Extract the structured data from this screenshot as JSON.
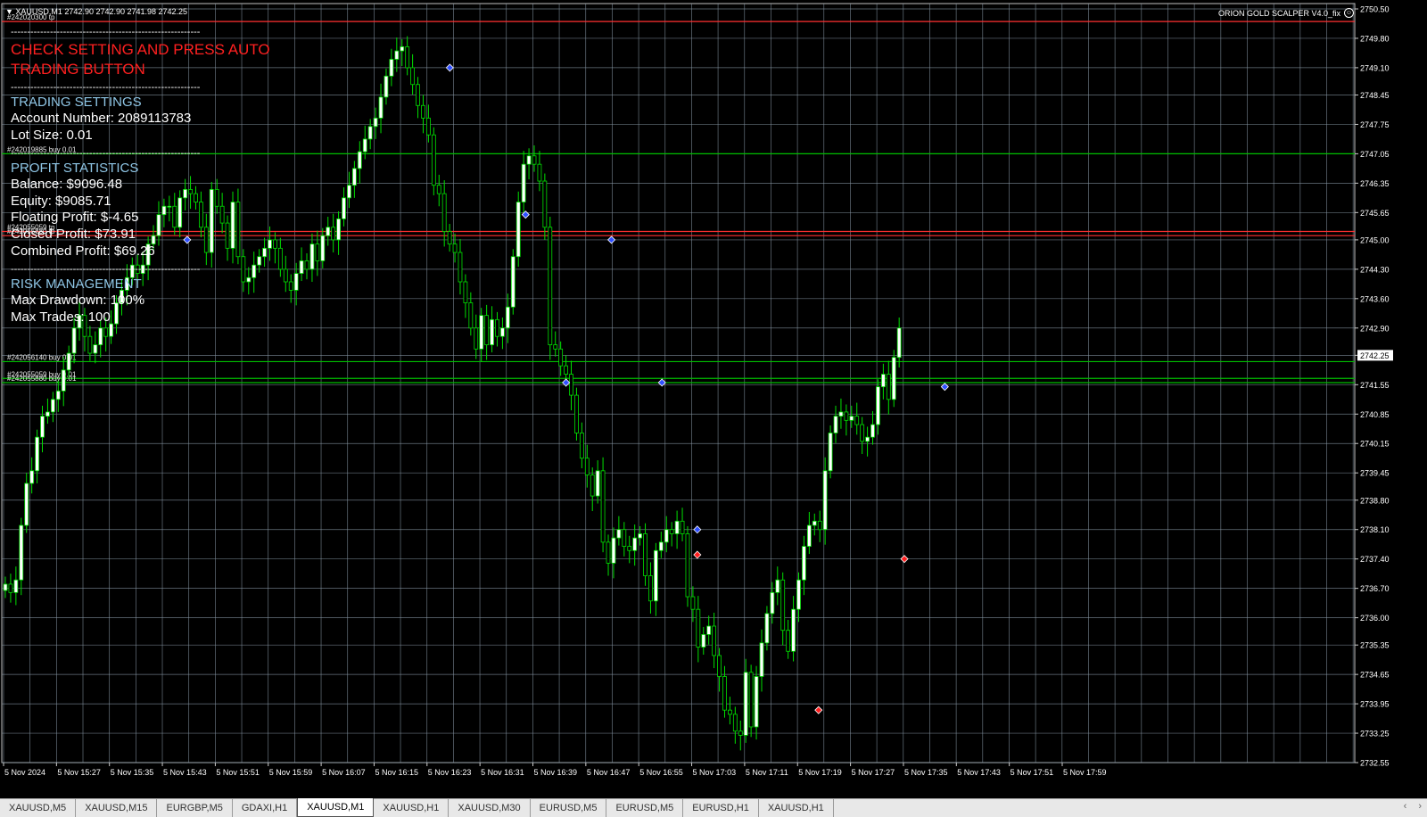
{
  "window": {
    "symbol_info": "▼ XAUUSD,M1  2742.90 2742.90 2741.98 2742.25",
    "ea_name": "ORION GOLD SCALPER V4.0_fix",
    "ea_icon": "smiley-icon"
  },
  "panel": {
    "separator": "----------------------------------------------------------",
    "warning": "CHECK SETTING AND PRESS AUTO TRADING BUTTON",
    "trading_settings": {
      "title": "TRADING SETTINGS",
      "account": "Account Number: 2089113783",
      "lot": "Lot Size: 0.01"
    },
    "profit_statistics": {
      "title": "PROFIT STATISTICS",
      "balance": "Balance: $9096.48",
      "equity": "Equity: $9085.71",
      "floating": "Floating Profit: $-4.65",
      "closed": "Closed Profit: $73.91",
      "combined": "Combined Profit: $69.26"
    },
    "risk_management": {
      "title": "RISK MANAGEMENT",
      "drawdown": "Max Drawdown: 100%",
      "trades": "Max Trades: 100"
    }
  },
  "order_labels": [
    {
      "text": "#242020300 tp",
      "price": 2750.2,
      "color": "#ff3030"
    },
    {
      "text": "#242019885 buy 0.01",
      "price": 2747.05,
      "color": "#00c000"
    },
    {
      "text": "#242055059 tp",
      "price": 2745.2,
      "color": "#ff3030"
    },
    {
      "text": "#242055880 tp",
      "price": 2745.1,
      "color": "#ff3030"
    },
    {
      "text": "#242056140 buy 0.01",
      "price": 2742.1,
      "color": "#00c000"
    },
    {
      "text": "#242055059 buy 0.01",
      "price": 2741.7,
      "color": "#00c000"
    },
    {
      "text": "#242055880 buy 0.01",
      "price": 2741.6,
      "color": "#00c000"
    }
  ],
  "colors": {
    "grid": "#8a9aa8",
    "bull_body": "#ffffff",
    "wick": "#00e000",
    "tp_line": "#d01010",
    "entry_line": "#00a000",
    "axis_text": "#ffffff",
    "price_box_bg": "#ffffff",
    "arrow_buy": "#3050ff",
    "arrow_sell": "#ff2020"
  },
  "price_axis": {
    "labels": [
      "2750.50",
      "2749.80",
      "2749.10",
      "2748.45",
      "2747.75",
      "2747.05",
      "2746.35",
      "2745.65",
      "2745.00",
      "2744.30",
      "2743.60",
      "2742.90",
      "2742.25",
      "2741.55",
      "2740.85",
      "2740.15",
      "2739.45",
      "2738.80",
      "2738.10",
      "2737.40",
      "2736.70",
      "2736.00",
      "2735.35",
      "2734.65",
      "2733.95",
      "2733.25",
      "2732.55"
    ],
    "current_price": "2742.25"
  },
  "time_axis": {
    "labels": [
      "5 Nov 2024",
      "5 Nov 15:27",
      "5 Nov 15:35",
      "5 Nov 15:43",
      "5 Nov 15:51",
      "5 Nov 15:59",
      "5 Nov 16:07",
      "5 Nov 16:15",
      "5 Nov 16:23",
      "5 Nov 16:31",
      "5 Nov 16:39",
      "5 Nov 16:47",
      "5 Nov 16:55",
      "5 Nov 17:03",
      "5 Nov 17:11",
      "5 Nov 17:19",
      "5 Nov 17:27",
      "5 Nov 17:35",
      "5 Nov 17:43",
      "5 Nov 17:51",
      "5 Nov 17:59"
    ]
  },
  "tabs": [
    {
      "label": "XAUUSD,M5",
      "active": false
    },
    {
      "label": "XAUUSD,M15",
      "active": false
    },
    {
      "label": "EURGBP,M5",
      "active": false
    },
    {
      "label": "GDAXI,H1",
      "active": false
    },
    {
      "label": "XAUUSD,M1",
      "active": true
    },
    {
      "label": "XAUUSD,H1",
      "active": false
    },
    {
      "label": "XAUUSD,M30",
      "active": false
    },
    {
      "label": "EURUSD,M5",
      "active": false
    },
    {
      "label": "EURUSD,M5",
      "active": false
    },
    {
      "label": "EURUSD,H1",
      "active": false
    },
    {
      "label": "XAUUSD,H1",
      "active": false
    }
  ],
  "tab_nav": {
    "prev": "‹",
    "next": "›"
  },
  "chart_data": {
    "type": "candlestick",
    "symbol": "XAUUSD",
    "timeframe": "M1",
    "ylim": [
      2732.55,
      2750.5
    ],
    "close": [
      2736.8,
      2736.6,
      2736.9,
      2738.2,
      2739.2,
      2739.5,
      2740.3,
      2740.8,
      2740.9,
      2741.2,
      2741.4,
      2741.9,
      2742.3,
      2742.9,
      2743.2,
      2742.7,
      2742.3,
      2742.5,
      2742.9,
      2742.7,
      2743.0,
      2743.5,
      2743.8,
      2744.1,
      2744.4,
      2744.2,
      2744.4,
      2744.9,
      2745.1,
      2745.6,
      2745.8,
      2745.8,
      2745.3,
      2746.0,
      2746.2,
      2746.1,
      2745.9,
      2745.3,
      2744.7,
      2746.2,
      2745.8,
      2745.4,
      2744.8,
      2745.9,
      2744.6,
      2744.0,
      2744.1,
      2744.4,
      2744.6,
      2744.8,
      2745.0,
      2744.8,
      2744.3,
      2744.0,
      2743.8,
      2744.2,
      2744.5,
      2744.3,
      2744.9,
      2744.5,
      2745.1,
      2745.3,
      2745.0,
      2745.5,
      2746.0,
      2746.3,
      2746.7,
      2747.1,
      2747.4,
      2747.7,
      2747.9,
      2748.4,
      2748.9,
      2749.3,
      2749.5,
      2749.6,
      2749.1,
      2748.7,
      2748.2,
      2747.9,
      2747.5,
      2746.3,
      2746.1,
      2745.2,
      2744.9,
      2744.7,
      2744.0,
      2743.5,
      2742.9,
      2742.4,
      2743.2,
      2742.5,
      2743.1,
      2742.7,
      2742.9,
      2743.4,
      2744.6,
      2745.9,
      2746.8,
      2747.0,
      2746.8,
      2746.4,
      2745.3,
      2742.5,
      2742.4,
      2742.0,
      2741.8,
      2741.3,
      2740.4,
      2739.8,
      2739.4,
      2738.9,
      2739.5,
      2737.8,
      2737.3,
      2737.9,
      2738.1,
      2737.7,
      2737.6,
      2737.9,
      2738.0,
      2737.0,
      2736.4,
      2737.6,
      2737.8,
      2738.1,
      2738.0,
      2738.3,
      2738.0,
      2736.5,
      2736.2,
      2735.3,
      2735.6,
      2735.8,
      2735.1,
      2734.6,
      2733.8,
      2733.7,
      2733.3,
      2733.2,
      2734.7,
      2733.4,
      2734.6,
      2735.4,
      2736.1,
      2736.6,
      2736.9,
      2735.7,
      2735.2,
      2736.2,
      2736.9,
      2737.7,
      2738.2,
      2738.3,
      2738.1,
      2739.5,
      2740.4,
      2740.8,
      2740.9,
      2740.7,
      2740.8,
      2740.6,
      2740.2,
      2740.3,
      2740.6,
      2741.5,
      2741.8,
      2741.2,
      2742.2,
      2742.9
    ]
  }
}
